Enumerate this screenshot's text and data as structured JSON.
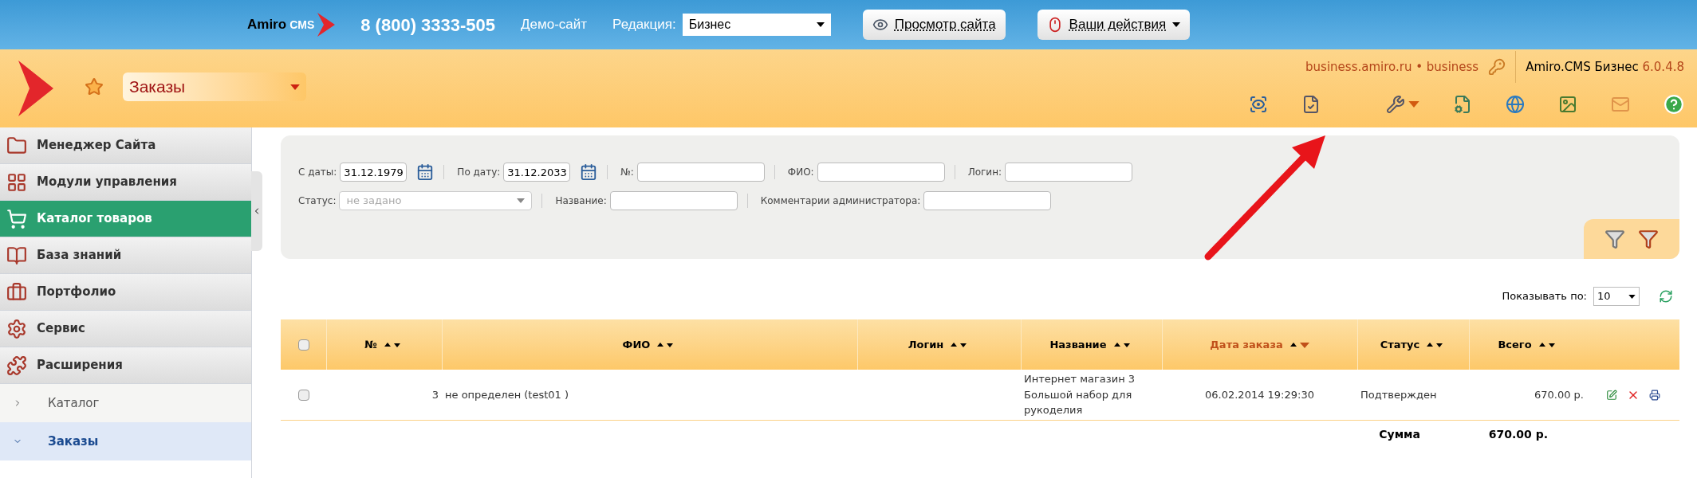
{
  "top_bar": {
    "logo": {
      "brand": "Amiro",
      "product": "CMS"
    },
    "phone": "8 (800) 3333-505",
    "demo_link": "Демо-сайт",
    "edition_label": "Редакция:",
    "edition_value": "Бизнес",
    "buttons": [
      {
        "kind": "view",
        "label": "Просмотр сайта"
      },
      {
        "kind": "actions",
        "label": "Ваши действия"
      }
    ]
  },
  "header": {
    "section": "Заказы",
    "site": "business.amiro.ru • business",
    "product": "Amiro.CMS Бизнес",
    "version": "6.0.4.8"
  },
  "sidebar": {
    "items": [
      {
        "label": "Менеджер Сайта",
        "selected": false
      },
      {
        "label": "Модули управления",
        "selected": false
      },
      {
        "label": "Каталог товаров",
        "selected": true
      },
      {
        "label": "База знаний",
        "selected": false
      },
      {
        "label": "Портфолио",
        "selected": false
      },
      {
        "label": "Сервис",
        "selected": false
      },
      {
        "label": "Расширения",
        "selected": false
      }
    ],
    "sub_items": [
      {
        "label": "Каталог",
        "selected": false,
        "expanded": false
      },
      {
        "label": "Заказы",
        "selected": true,
        "expanded": true
      }
    ]
  },
  "filters": {
    "lines": [
      {
        "fields": [
          {
            "kind": "date",
            "label": "С даты:",
            "value": "31.12.1979"
          },
          {
            "kind": "date",
            "label": "По дату:",
            "value": "31.12.2033"
          },
          {
            "kind": "text",
            "label": "№:"
          },
          {
            "kind": "text",
            "label": "ФИО:"
          },
          {
            "kind": "text",
            "label": "Логин:"
          }
        ]
      },
      {
        "fields": [
          {
            "kind": "select",
            "label": "Статус:",
            "placeholder": "не задано"
          },
          {
            "kind": "text",
            "label": "Название:"
          },
          {
            "kind": "text",
            "label": "Комментарии администратора:"
          }
        ]
      }
    ]
  },
  "page_size": {
    "label": "Показывать по:",
    "value": "10"
  },
  "table": {
    "select_all_checked": false,
    "columns": [
      {
        "label": "№",
        "sorted": false
      },
      {
        "label": "ФИО",
        "sorted": false
      },
      {
        "label": "Логин",
        "sorted": false
      },
      {
        "label": "Название",
        "sorted": false
      },
      {
        "label": "Дата заказа",
        "sorted": true
      },
      {
        "label": "Статус",
        "sorted": false
      },
      {
        "label": "Всего",
        "sorted": false
      }
    ],
    "rows": [
      {
        "checked": false,
        "cells": [
          "3",
          "не определен (test01 )",
          "",
          "Интернет магазин 3 Большой набор для рукоделия",
          "06.02.2014 19:29:30",
          "Подтвержден",
          "670.00 р."
        ]
      }
    ],
    "total_label": "Сумма",
    "total_value": "670.00 р."
  }
}
